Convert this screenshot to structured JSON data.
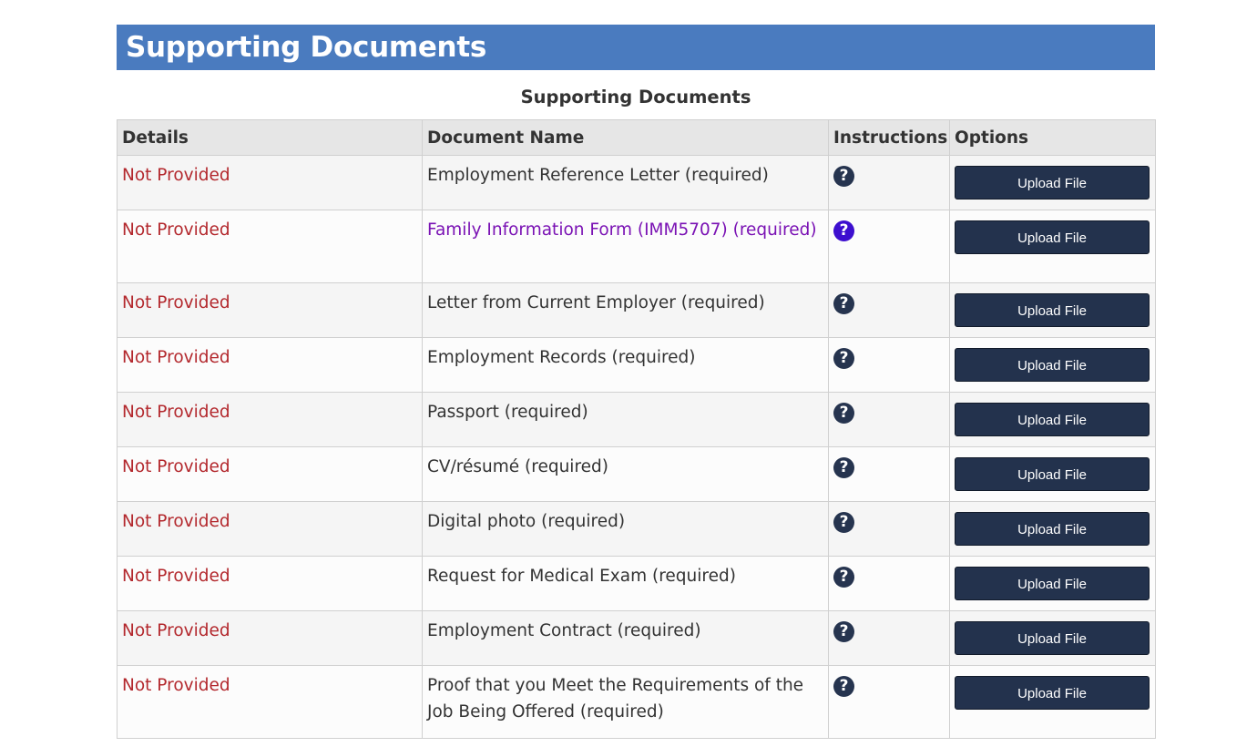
{
  "page": {
    "banner_title": "Supporting Documents",
    "table_caption": "Supporting Documents"
  },
  "table": {
    "headers": {
      "details": "Details",
      "document_name": "Document Name",
      "instructions": "Instructions",
      "options": "Options"
    },
    "help_icon_glyph": "?",
    "rows": [
      {
        "status": "Not Provided",
        "document": "Employment Reference Letter  (required)",
        "action": "Upload File"
      },
      {
        "status": "Not Provided",
        "document": "Family Information Form (IMM5707)  (required)",
        "action": "Upload File"
      },
      {
        "status": "Not Provided",
        "document": "Letter from Current Employer  (required)",
        "action": "Upload File"
      },
      {
        "status": "Not Provided",
        "document": "Employment Records  (required)",
        "action": "Upload File"
      },
      {
        "status": "Not Provided",
        "document": "Passport  (required)",
        "action": "Upload File"
      },
      {
        "status": "Not Provided",
        "document": "CV/résumé  (required)",
        "action": "Upload File"
      },
      {
        "status": "Not Provided",
        "document": "Digital photo  (required)",
        "action": "Upload File"
      },
      {
        "status": "Not Provided",
        "document": "Request for Medical Exam  (required)",
        "action": "Upload File"
      },
      {
        "status": "Not Provided",
        "document": "Employment Contract  (required)",
        "action": "Upload File"
      },
      {
        "status": "Not Provided",
        "document": "Proof that you Meet the Requirements of the Job Being Offered  (required)",
        "action": "Upload File"
      }
    ]
  },
  "colors": {
    "banner": "#4a7bbf",
    "status_not_provided": "#b3282d",
    "visited_link": "#7a12b4",
    "button": "#23324d",
    "help_icon": "#26344f",
    "help_icon_visited": "#3d0fcf"
  },
  "icons": {
    "instructions": "question-circle-icon"
  }
}
